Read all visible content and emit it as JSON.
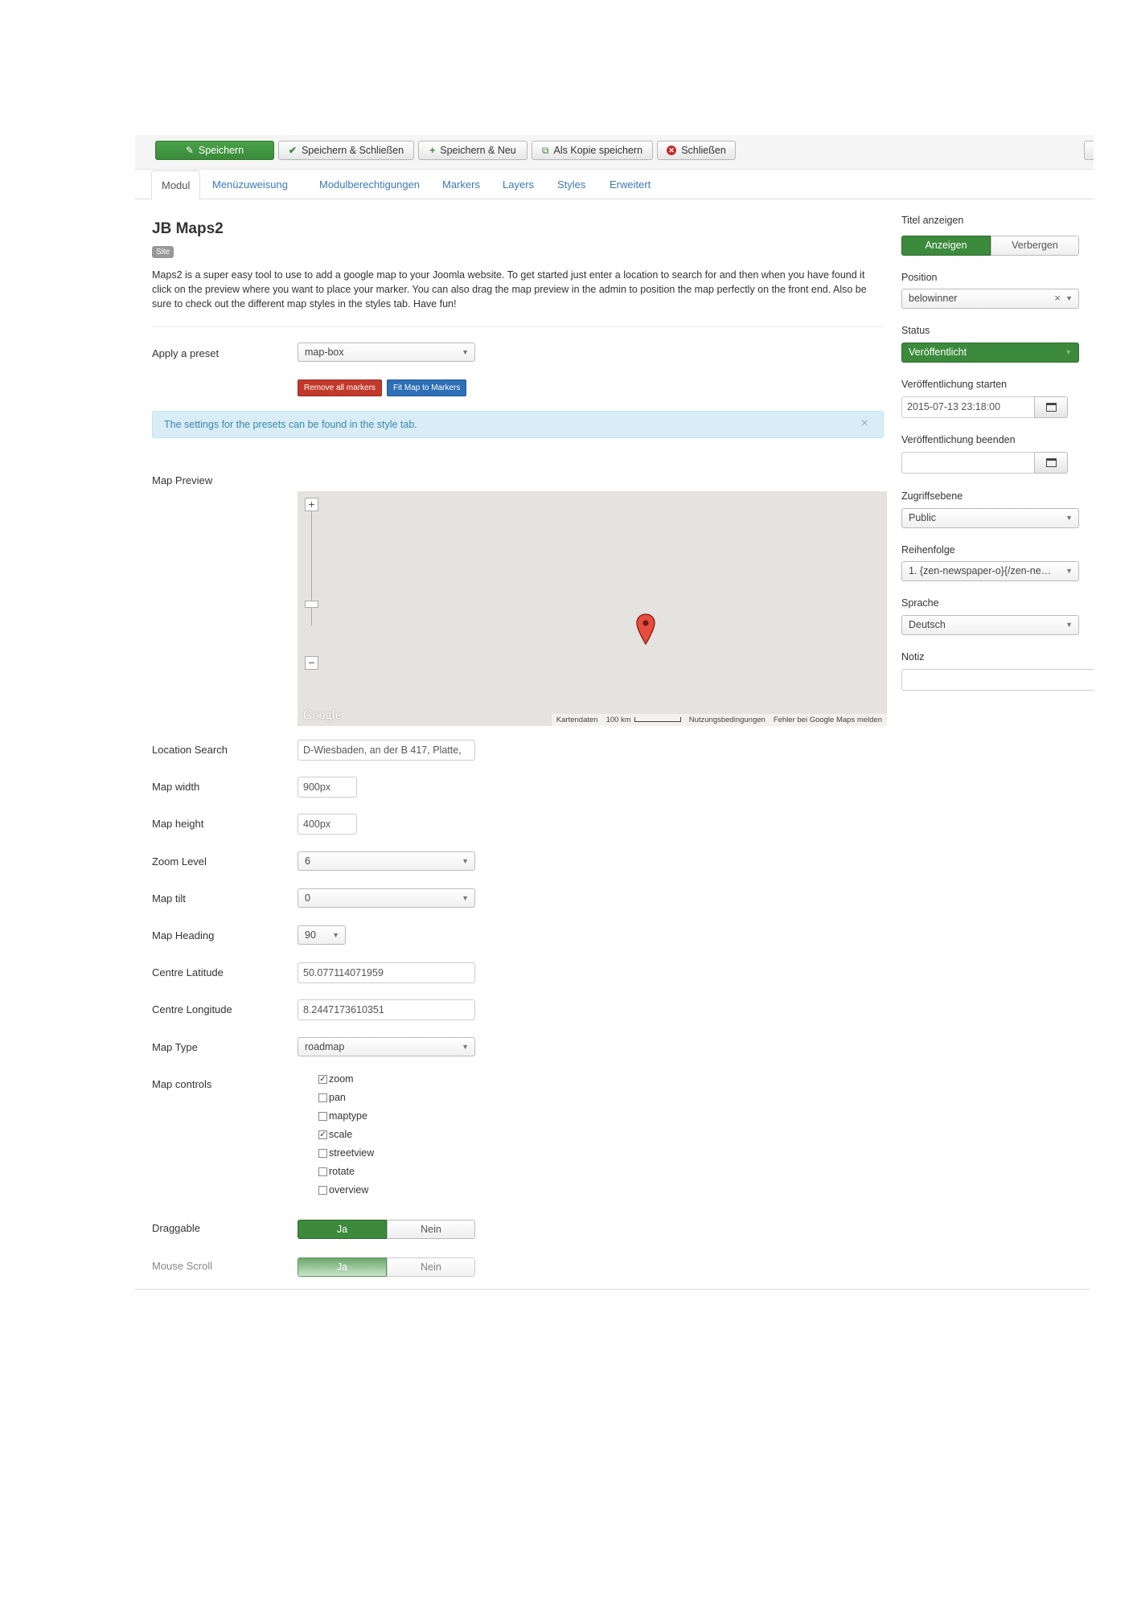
{
  "toolbar": {
    "save": "Speichern",
    "save_close": "Speichern & Schließen",
    "save_new": "Speichern & Neu",
    "save_copy": "Als Kopie speichern",
    "close": "Schließen"
  },
  "tabs": [
    "Modul",
    "Menüzuweisung",
    "Modulberechtigungen",
    "Markers",
    "Layers",
    "Styles",
    "Erweitert"
  ],
  "module": {
    "title": "JB Maps2",
    "badge": "Site",
    "description": "Maps2 is a super easy tool to use to add a google map to your Joomla website. To get started just enter a location to search for and then when you have found it click on the preview where you want to place your marker. You can also drag the map preview in the admin to position the map perfectly on the front end. Also be sure to check out the different map styles in the styles tab. Have fun!"
  },
  "preset": {
    "label": "Apply a preset",
    "value": "map-box",
    "remove_markers": "Remove all markers",
    "fit_map": "Fit Map to Markers"
  },
  "alert": {
    "text": "The settings for the presets can be found in the style tab.",
    "close": "×"
  },
  "map_preview": {
    "label": "Map Preview",
    "zoom_in": "+",
    "zoom_out": "−",
    "watermark": "Google",
    "footer": {
      "data": "Kartendaten",
      "scale": "100 km",
      "terms": "Nutzungsbedingungen",
      "report": "Fehler bei Google Maps melden"
    }
  },
  "fields": {
    "location_search": {
      "label": "Location Search",
      "value": "D-Wiesbaden, an der B 417, Platte,"
    },
    "map_width": {
      "label": "Map width",
      "value": "900px"
    },
    "map_height": {
      "label": "Map height",
      "value": "400px"
    },
    "zoom_level": {
      "label": "Zoom Level",
      "value": "6"
    },
    "map_tilt": {
      "label": "Map tilt",
      "value": "0"
    },
    "map_heading": {
      "label": "Map Heading",
      "value": "90"
    },
    "centre_latitude": {
      "label": "Centre Latitude",
      "value": "50.077114071959"
    },
    "centre_longitude": {
      "label": "Centre Longitude",
      "value": "8.2447173610351"
    },
    "map_type": {
      "label": "Map Type",
      "value": "roadmap"
    }
  },
  "map_controls": {
    "label": "Map controls",
    "items": [
      {
        "name": "zoom",
        "checked": true,
        "mark": "✓"
      },
      {
        "name": "pan",
        "checked": false,
        "mark": ""
      },
      {
        "name": "maptype",
        "checked": false,
        "mark": ""
      },
      {
        "name": "scale",
        "checked": true,
        "mark": "✓"
      },
      {
        "name": "streetview",
        "checked": false,
        "mark": ""
      },
      {
        "name": "rotate",
        "checked": false,
        "mark": ""
      },
      {
        "name": "overview",
        "checked": false,
        "mark": ""
      }
    ]
  },
  "draggable": {
    "label": "Draggable",
    "yes": "Ja",
    "no": "Nein",
    "selected": "Ja"
  },
  "mouse_scroll": {
    "label": "Mouse Scroll",
    "yes": "Ja",
    "no": "Nein",
    "selected": "Ja"
  },
  "sidebar": {
    "show_title": {
      "label": "Titel anzeigen",
      "show": "Anzeigen",
      "hide": "Verbergen",
      "selected": "Anzeigen"
    },
    "position": {
      "label": "Position",
      "value": "belowinner",
      "clear": "×"
    },
    "status": {
      "label": "Status",
      "value": "Veröffentlicht"
    },
    "publish_start": {
      "label": "Veröffentlichung starten",
      "value": "2015-07-13 23:18:00"
    },
    "publish_end": {
      "label": "Veröffentlichung beenden",
      "value": ""
    },
    "access": {
      "label": "Zugriffsebene",
      "value": "Public"
    },
    "ordering": {
      "label": "Reihenfolge",
      "value": "1. {zen-newspaper-o}{/zen-ne…"
    },
    "language": {
      "label": "Sprache",
      "value": "Deutsch"
    },
    "note": {
      "label": "Notiz",
      "value": ""
    }
  },
  "colors": {
    "primary_green": "#3c8a3c",
    "link_blue": "#3b7ab8",
    "danger_red": "#c0392b",
    "info_bg": "#d9edf7"
  }
}
